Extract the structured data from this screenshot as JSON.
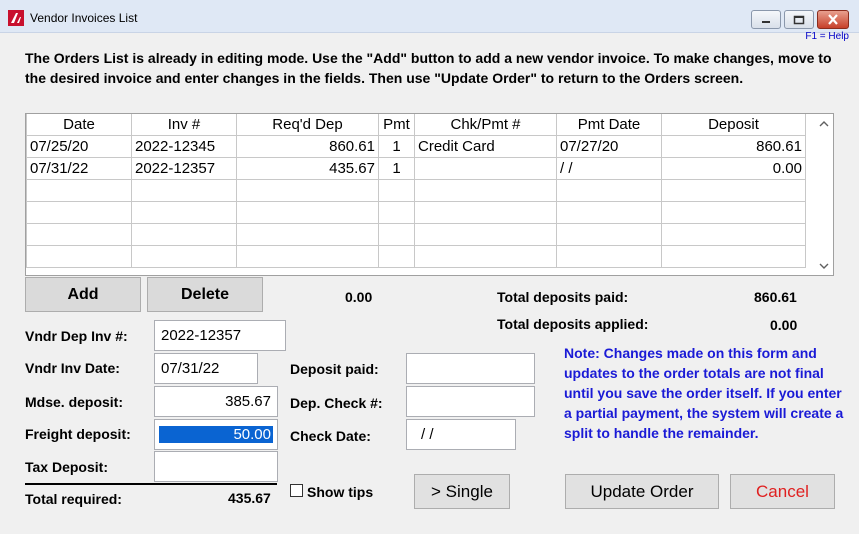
{
  "window": {
    "title": "Vendor Invoices List",
    "help": "F1 = Help"
  },
  "intro_text": "The Orders List is already in editing mode. Use the \"Add\" button to add a new vendor invoice. To make changes, move to the desired invoice and enter changes in the fields. Then use \"Update Order\" to return to the Orders screen.",
  "grid": {
    "columns": [
      "Date",
      "Inv #",
      "Req'd Dep",
      "Pmt",
      "Chk/Pmt #",
      "Pmt Date",
      "Deposit"
    ],
    "rows": [
      [
        "07/25/20",
        "2022-12345",
        "860.61",
        "1",
        "Credit Card",
        "07/27/20",
        "860.61"
      ],
      [
        "07/31/22",
        "2022-12357",
        "435.67",
        "1",
        "",
        "/  /",
        "0.00"
      ],
      [
        "",
        "",
        "",
        "",
        "",
        "",
        ""
      ],
      [
        "",
        "",
        "",
        "",
        "",
        "",
        ""
      ],
      [
        "",
        "",
        "",
        "",
        "",
        "",
        ""
      ],
      [
        "",
        "",
        "",
        "",
        "",
        "",
        ""
      ]
    ]
  },
  "buttons": {
    "add": "Add",
    "delete": "Delete",
    "single": "> Single",
    "update": "Update Order",
    "cancel": "Cancel"
  },
  "grid_total": "0.00",
  "summary": {
    "total_deposits_paid_label": "Total deposits paid:",
    "total_deposits_paid": "860.61",
    "total_deposits_applied_label": "Total deposits applied:",
    "total_deposits_applied": "0.00"
  },
  "form": {
    "vndr_dep_inv_label": "Vndr Dep Inv #:",
    "vndr_dep_inv": "2022-12357",
    "vndr_inv_date_label": "Vndr Inv Date:",
    "vndr_inv_date": "07/31/22",
    "mdse_deposit_label": "Mdse. deposit:",
    "mdse_deposit": "385.67",
    "freight_deposit_label": "Freight deposit:",
    "freight_deposit": "50.00",
    "tax_deposit_label": "Tax Deposit:",
    "tax_deposit": "",
    "total_required_label": "Total required:",
    "total_required": "435.67",
    "deposit_paid_label": "Deposit paid:",
    "deposit_paid": "",
    "dep_check_label": "Dep. Check #:",
    "dep_check": "",
    "check_date_label": "Check Date:",
    "check_date": "/  /",
    "show_tips_label": "Show tips"
  },
  "note": "Note: Changes made on this form and updates to the order totals are not final until you save the order itself.  If you enter a partial payment, the system will create a split to handle the remainder.",
  "colors": {
    "note": "#1a1ad6",
    "cancel": "#e02020",
    "selection": "#0a64d2",
    "help": "#0000c8"
  }
}
